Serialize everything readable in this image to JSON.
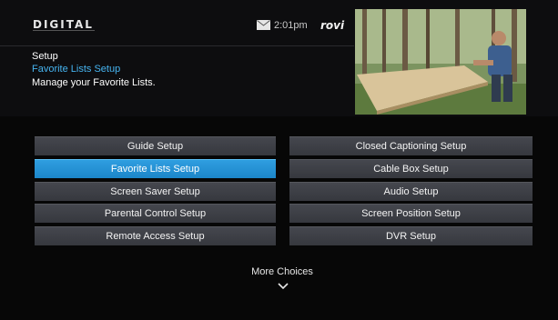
{
  "header": {
    "logo_text": "DIGITAL",
    "clock": "2:01pm",
    "brand": "rovi"
  },
  "breadcrumb": {
    "title": "Setup",
    "current": "Favorite Lists Setup",
    "description": "Manage your Favorite Lists."
  },
  "menu": {
    "left": [
      {
        "label": "Guide Setup",
        "selected": false
      },
      {
        "label": "Favorite Lists Setup",
        "selected": true
      },
      {
        "label": "Screen Saver Setup",
        "selected": false
      },
      {
        "label": "Parental Control Setup",
        "selected": false
      },
      {
        "label": "Remote Access Setup",
        "selected": false
      }
    ],
    "right": [
      {
        "label": "Closed Captioning Setup",
        "selected": false
      },
      {
        "label": "Cable Box Setup",
        "selected": false
      },
      {
        "label": "Audio Setup",
        "selected": false
      },
      {
        "label": "Screen Position Setup",
        "selected": false
      },
      {
        "label": "DVR Setup",
        "selected": false
      }
    ]
  },
  "footer": {
    "more_label": "More Choices"
  },
  "icons": {
    "mail": "mail-icon",
    "more": "chevron-down-icon"
  },
  "colors": {
    "selected": "#1e8fd6",
    "button": "#3e4046",
    "accent_text": "#46b4f0"
  }
}
